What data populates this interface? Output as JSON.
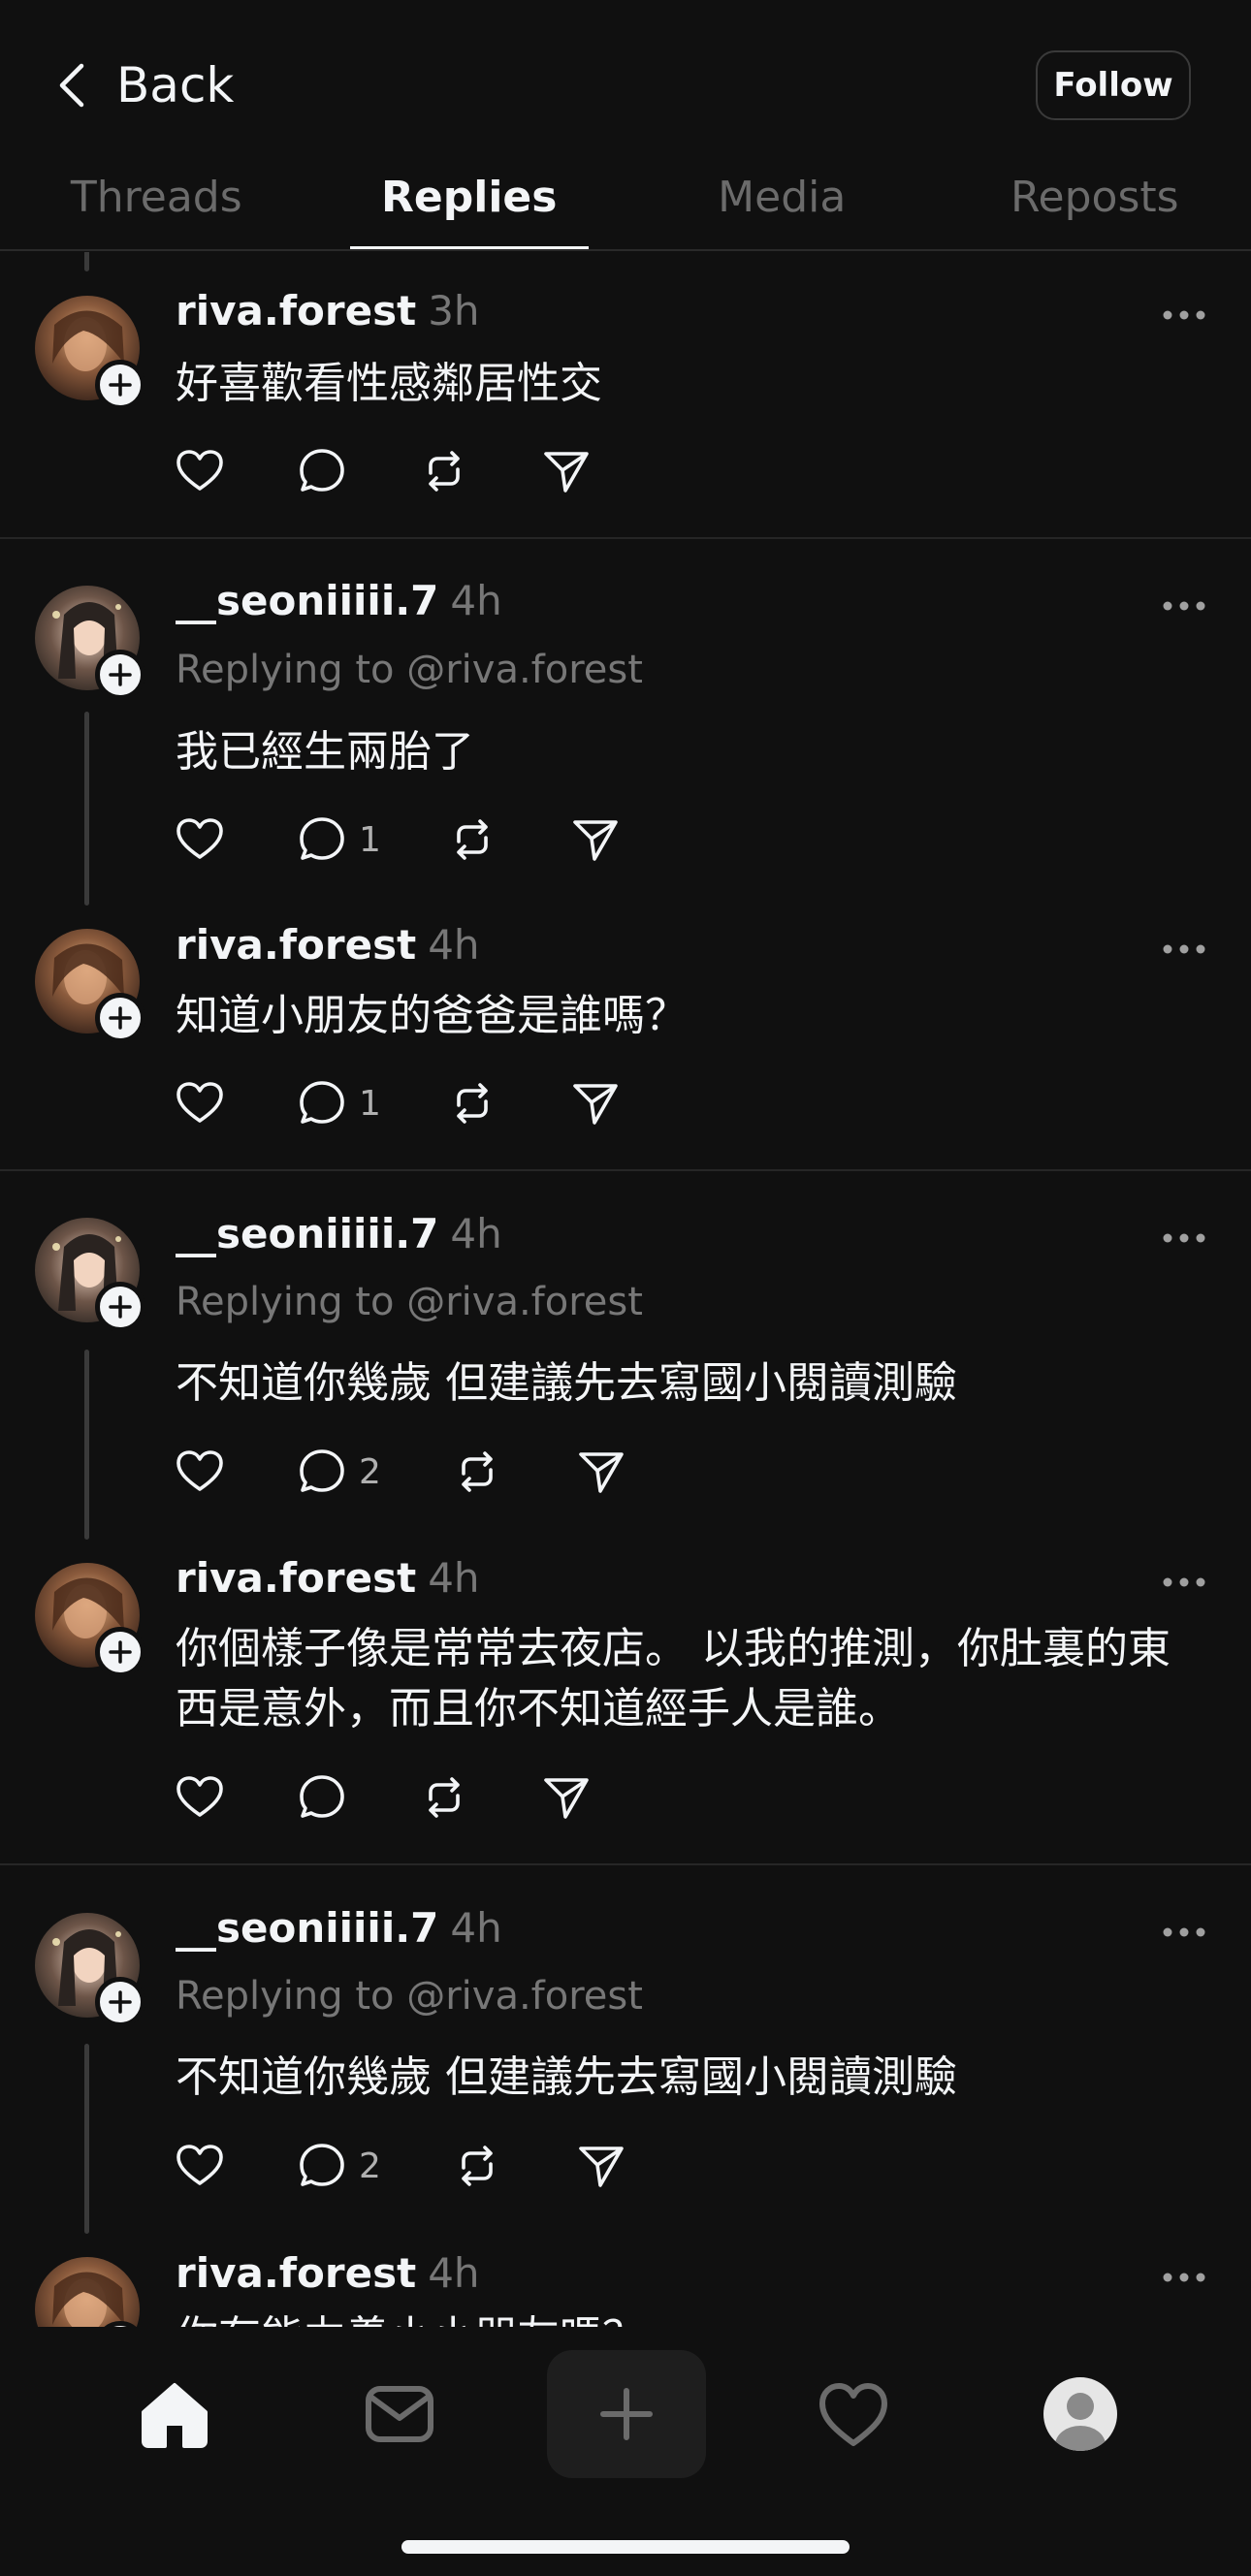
{
  "header": {
    "back_label": "Back",
    "follow_label": "Follow",
    "tabs": [
      {
        "label": "Threads",
        "active": false
      },
      {
        "label": "Replies",
        "active": true
      },
      {
        "label": "Media",
        "active": false
      },
      {
        "label": "Reposts",
        "active": false
      }
    ]
  },
  "posts": [
    {
      "username": "riva.forest",
      "time": "3h",
      "text": "好喜歡看性感鄰居性交",
      "reply_count": ""
    },
    {
      "username": "__seoniiiii.7",
      "time": "4h",
      "replying_to": "Replying to @riva.forest",
      "text": "我已經生兩胎了",
      "reply_count": "1"
    },
    {
      "username": "riva.forest",
      "time": "4h",
      "text": "知道小朋友的爸爸是誰嗎？",
      "reply_count": "1"
    },
    {
      "username": "__seoniiiii.7",
      "time": "4h",
      "replying_to": "Replying to @riva.forest",
      "text": "不知道你幾歲 但建議先去寫國小閱讀測驗",
      "reply_count": "2"
    },
    {
      "username": "riva.forest",
      "time": "4h",
      "text": "你個樣子像是常常去夜店。 以我的推測，你肚裏的東西是意外，而且你不知道經手人是誰。",
      "reply_count": ""
    },
    {
      "username": "__seoniiiii.7",
      "time": "4h",
      "replying_to": "Replying to @riva.forest",
      "text": "不知道你幾歲 但建議先去寫國小閱讀測驗",
      "reply_count": "2"
    },
    {
      "username": "riva.forest",
      "time": "4h",
      "text": "你有能力養小小朋友嗎？",
      "reply_count": ""
    }
  ],
  "nav": {
    "items": [
      "home-icon",
      "inbox-icon",
      "create-icon",
      "activity-icon",
      "profile-icon"
    ],
    "active": "home-icon"
  },
  "colors": {
    "background": "#101010",
    "text_primary": "#f3f5f7",
    "text_secondary": "#777777",
    "divider": "#262626"
  }
}
